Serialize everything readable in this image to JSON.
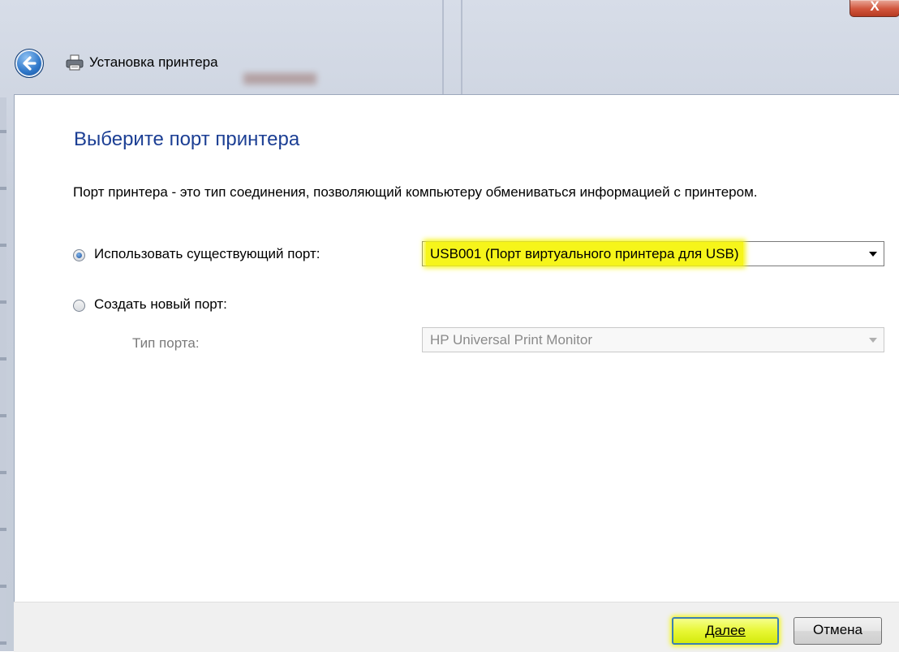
{
  "window": {
    "title": "Установка принтера",
    "close_glyph": "X"
  },
  "icons": {
    "back": "back-arrow-icon",
    "printer": "printer-icon",
    "close": "close-icon"
  },
  "main": {
    "heading": "Выберите порт принтера",
    "description": "Порт принтера - это тип соединения, позволяющий компьютеру обмениваться информацией с принтером.",
    "use_existing": {
      "label": "Использовать существующий порт:",
      "selected": true,
      "value": "USB001 (Порт виртуального принтера для USB)"
    },
    "create_new": {
      "label": "Создать новый порт:",
      "selected": false,
      "port_type_label": "Тип порта:",
      "port_type_value": "HP Universal Print Monitor"
    }
  },
  "footer": {
    "next_label": "Далее",
    "cancel_label": "Отмена"
  },
  "colors": {
    "heading": "#1c3f94",
    "highlight": "#f6f51a",
    "close_button": "#d1553c"
  }
}
